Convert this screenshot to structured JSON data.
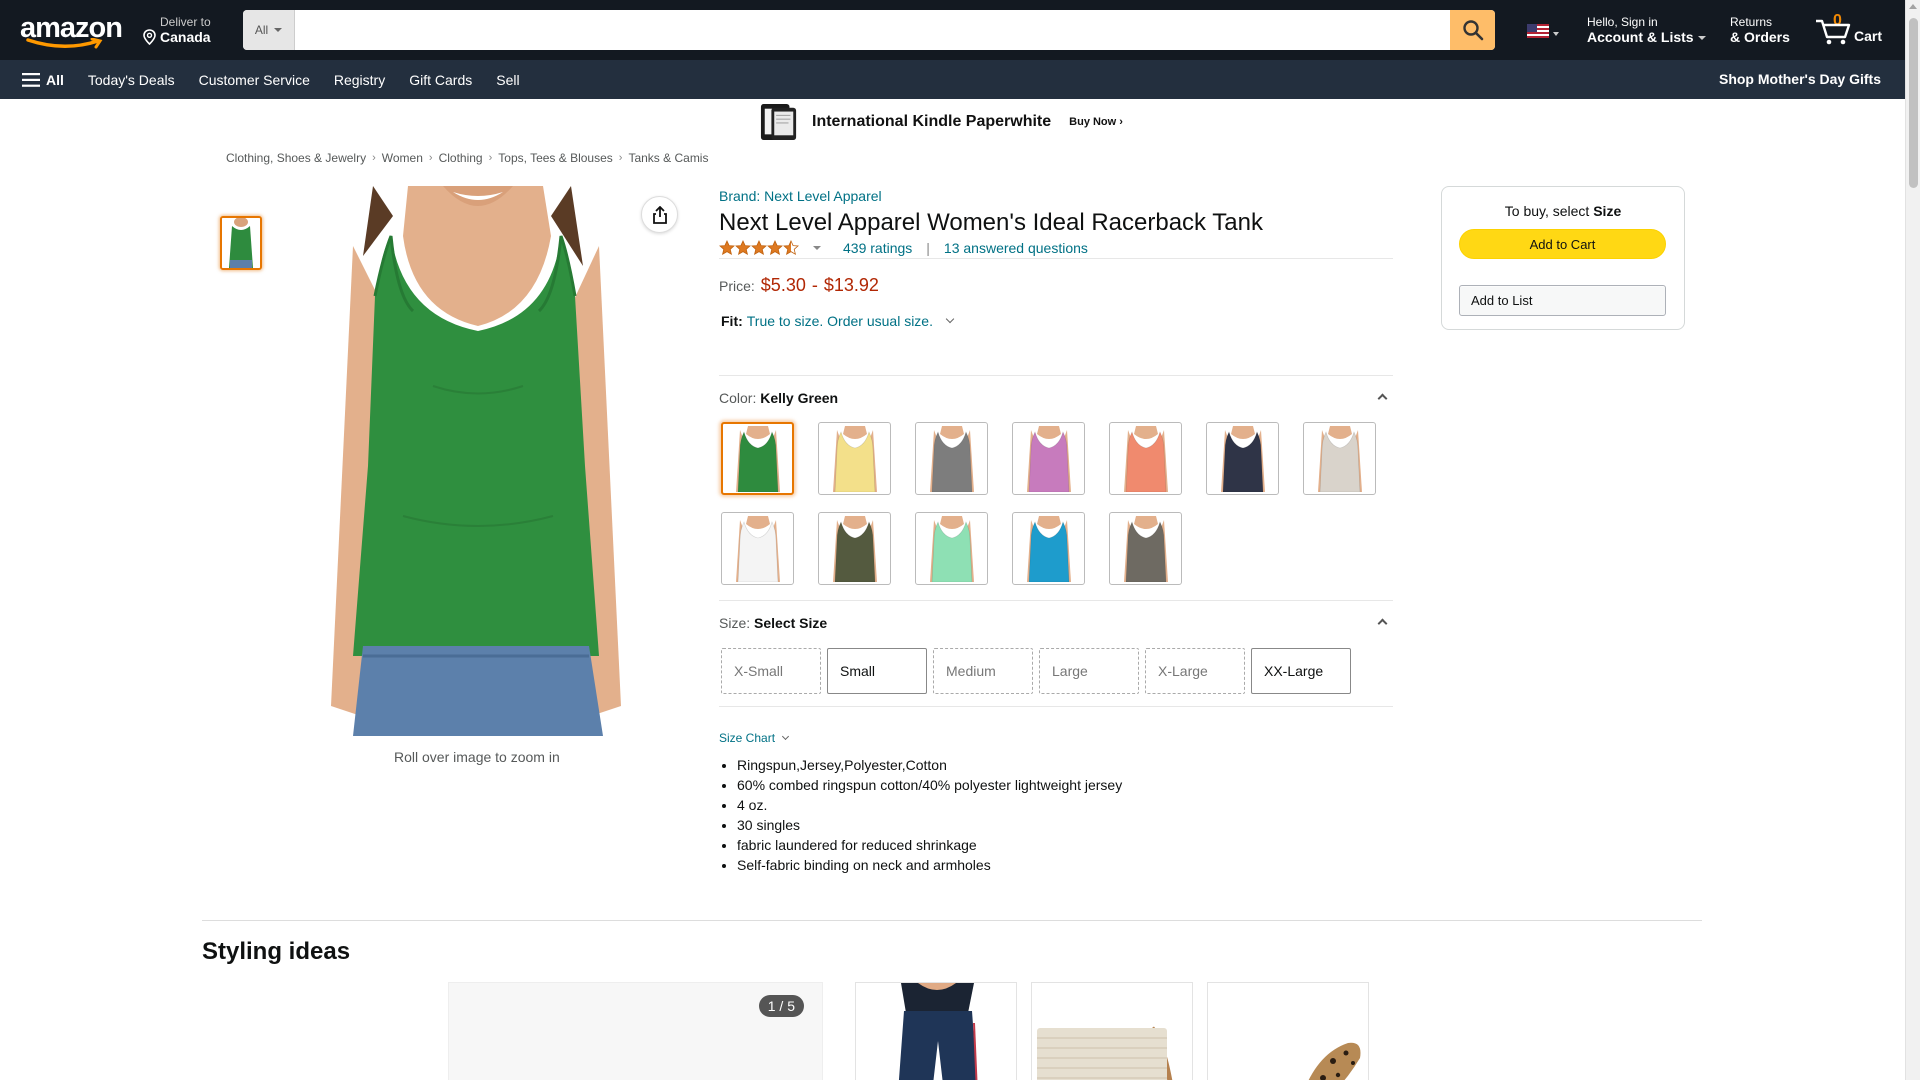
{
  "header": {
    "logo": "amazon",
    "deliver_line1": "Deliver to",
    "deliver_line2": "Canada",
    "search_category": "All",
    "search_placeholder": "",
    "account_line1": "Hello, Sign in",
    "account_line2": "Account & Lists",
    "returns_line1": "Returns",
    "returns_line2": "& Orders",
    "cart_count": "0",
    "cart_label": "Cart"
  },
  "nav": {
    "all": "All",
    "items": [
      "Today's Deals",
      "Customer Service",
      "Registry",
      "Gift Cards",
      "Sell"
    ],
    "promo": "Shop Mother's Day Gifts"
  },
  "banner": {
    "title": "International Kindle Paperwhite",
    "cta": "Buy Now ›"
  },
  "breadcrumb": [
    "Clothing, Shoes & Jewelry",
    "Women",
    "Clothing",
    "Tops, Tees & Blouses",
    "Tanks & Camis"
  ],
  "gallery": {
    "zoom_hint": "Roll over image to zoom in"
  },
  "product": {
    "brand": "Brand: Next Level Apparel",
    "title": "Next Level Apparel Women's Ideal Racerback Tank",
    "rating": 4.5,
    "ratings_count": "439 ratings",
    "answered": "13 answered questions",
    "price_label": "Price:",
    "price_low": "$5.30",
    "price_sep": "-",
    "price_high": "$13.92",
    "fit_label": "Fit:",
    "fit_value": "True to size. Order usual size.",
    "color_label": "Color:",
    "color_value": "Kelly Green",
    "colors": [
      "#2e8b3e",
      "#f3e08a",
      "#7d7d7d",
      "#c77bbd",
      "#f08a6e",
      "#2f3447",
      "#d9d3cb",
      "#f4f4f4",
      "#545a3f",
      "#8ee0b4",
      "#1e9ccc",
      "#6e6a62"
    ],
    "size_label": "Size:",
    "size_value": "Select Size",
    "sizes": [
      {
        "label": "X-Small",
        "available": false
      },
      {
        "label": "Small",
        "available": true
      },
      {
        "label": "Medium",
        "available": false
      },
      {
        "label": "Large",
        "available": false
      },
      {
        "label": "X-Large",
        "available": false
      },
      {
        "label": "XX-Large",
        "available": true
      }
    ],
    "size_chart": "Size Chart",
    "bullets": [
      "Ringspun,Jersey,Polyester,Cotton",
      "60% combed ringspun cotton/40% polyester lightweight jersey",
      "4 oz.",
      "30 singles",
      "fabric laundered for reduced shrinkage",
      "Self-fabric binding on neck and armholes"
    ]
  },
  "buybox": {
    "hint_prefix": "To buy, select",
    "hint_bold": "Size",
    "add_to_cart": "Add to Cart",
    "add_to_list": "Add to List"
  },
  "styling": {
    "title": "Styling ideas",
    "pager": "1 / 5"
  }
}
